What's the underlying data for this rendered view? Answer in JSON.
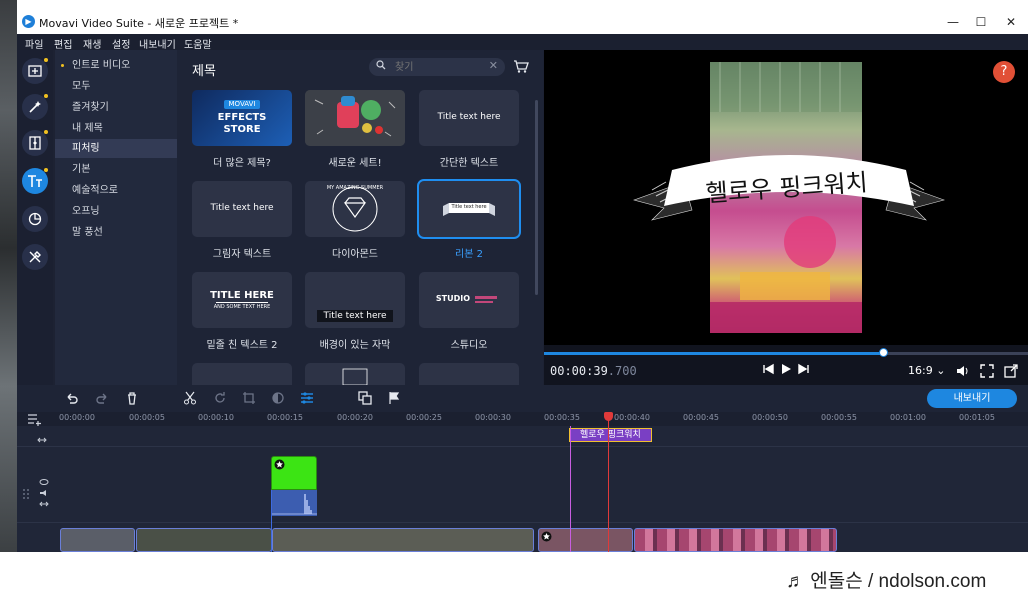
{
  "window": {
    "title": "Movavi Video Suite - 새로운 프로젝트 *",
    "minimize": "—",
    "maximize": "☐",
    "close": "✕"
  },
  "menu": [
    "파일",
    "편집",
    "재생",
    "설정",
    "내보내기",
    "도움말"
  ],
  "rail": [
    {
      "icon": "import-icon",
      "dot": false
    },
    {
      "icon": "magic-wand-icon",
      "dot": true
    },
    {
      "icon": "filters-icon",
      "dot": true
    },
    {
      "icon": "titles-icon",
      "dot": true,
      "active": true
    },
    {
      "icon": "stickers-icon",
      "dot": false
    },
    {
      "icon": "tools-icon",
      "dot": false
    }
  ],
  "categories": [
    {
      "label": "인트로 비디오",
      "bullet": true
    },
    {
      "label": "모두"
    },
    {
      "label": "즐겨찾기"
    },
    {
      "label": "내 제목"
    },
    {
      "label": "피처링",
      "selected": true
    },
    {
      "label": "기본"
    },
    {
      "label": "예술적으로"
    },
    {
      "label": "오프닝"
    },
    {
      "label": "말 풍선"
    }
  ],
  "panel": {
    "title": "제목",
    "search_placeholder": "찾기",
    "clear": "✕"
  },
  "tiles": [
    {
      "label": "더 많은 제목?",
      "thumb_top": "MOVAVI",
      "thumb_main": "EFFECTS\nSTORE"
    },
    {
      "label": "새로운 세트!"
    },
    {
      "label": "간단한 텍스트",
      "thumb_text": "Title text here"
    },
    {
      "label": "그림자 텍스트",
      "thumb_text": "Title text here"
    },
    {
      "label": "다이아몬드",
      "thumb_text": "MY AMAZING SUMMER"
    },
    {
      "label": "리본 2",
      "active": true,
      "thumb_text": "Title text here"
    },
    {
      "label": "밑줄 친 텍스트 2",
      "thumb_main": "TITLE HERE",
      "thumb_sub": "AND SOME TEXT HERE"
    },
    {
      "label": "배경이 있는 자막",
      "thumb_text": "Title text here"
    },
    {
      "label": "스튜디오",
      "thumb_text": "STUDIO"
    }
  ],
  "preview": {
    "title_text": "헬로우 핑크워치",
    "help": "?",
    "timecode_main": "00:00:39",
    "timecode_ms": ".700",
    "aspect_ratio": "16:9 ⌄",
    "progress": 0.703
  },
  "toolbar": {
    "export_label": "내보내기"
  },
  "ruler": [
    "00:00:00",
    "00:00:05",
    "00:00:10",
    "00:00:15",
    "00:00:20",
    "00:00:25",
    "00:00:30",
    "00:00:35",
    "00:00:40",
    "00:00:45",
    "00:00:50",
    "00:00:55",
    "00:01:00",
    "00:01:05"
  ],
  "timeline": {
    "title_clip": "헬로우 핑크워치"
  },
  "watermark": "♬ 엔돌슨 / ndolson.com",
  "colors": {
    "accent": "#1e87e0",
    "background": "#1d2233",
    "help": "#e15036",
    "playhead": "#e03a3a",
    "title_clip": "#7a3fc4",
    "green_clip": "#3ce414"
  }
}
